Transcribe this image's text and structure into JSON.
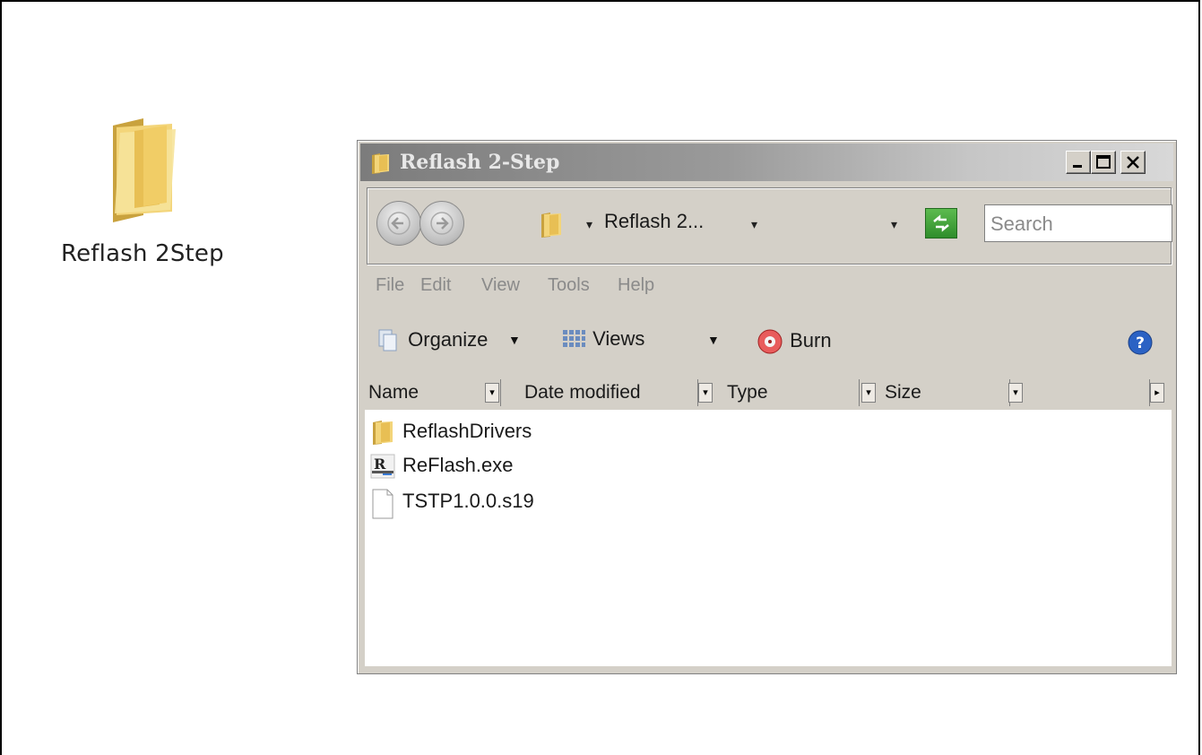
{
  "desktop": {
    "folder_label": "Reflash 2Step",
    "icon": "folder-icon"
  },
  "window": {
    "title": "Reflash 2-Step",
    "title_icon": "folder-icon",
    "controls": {
      "minimize": "_",
      "maximize": "□",
      "close": "✕"
    },
    "address": {
      "path": "Reflash 2...",
      "chevron": "▾",
      "dropdown": "▾"
    },
    "search": {
      "placeholder": "Search"
    },
    "menu": [
      "File",
      "Edit",
      "View",
      "Tools",
      "Help"
    ],
    "toolbar": {
      "organize": "Organize",
      "views": "Views",
      "burn": "Burn",
      "arrow": "▼"
    },
    "columns": [
      "Name",
      "Date modified",
      "Type",
      "Size"
    ],
    "files": [
      {
        "name": "ReflashDrivers",
        "icon": "folder-icon"
      },
      {
        "name": "ReFlash.exe",
        "icon": "exe-icon"
      },
      {
        "name": "TSTP1.0.0.s19",
        "icon": "file-icon"
      }
    ]
  },
  "colors": {
    "window_bg": "#d4d0c8",
    "title_gradient_start": "#7c7c7c",
    "folder_yellow": "#f0c75a"
  }
}
